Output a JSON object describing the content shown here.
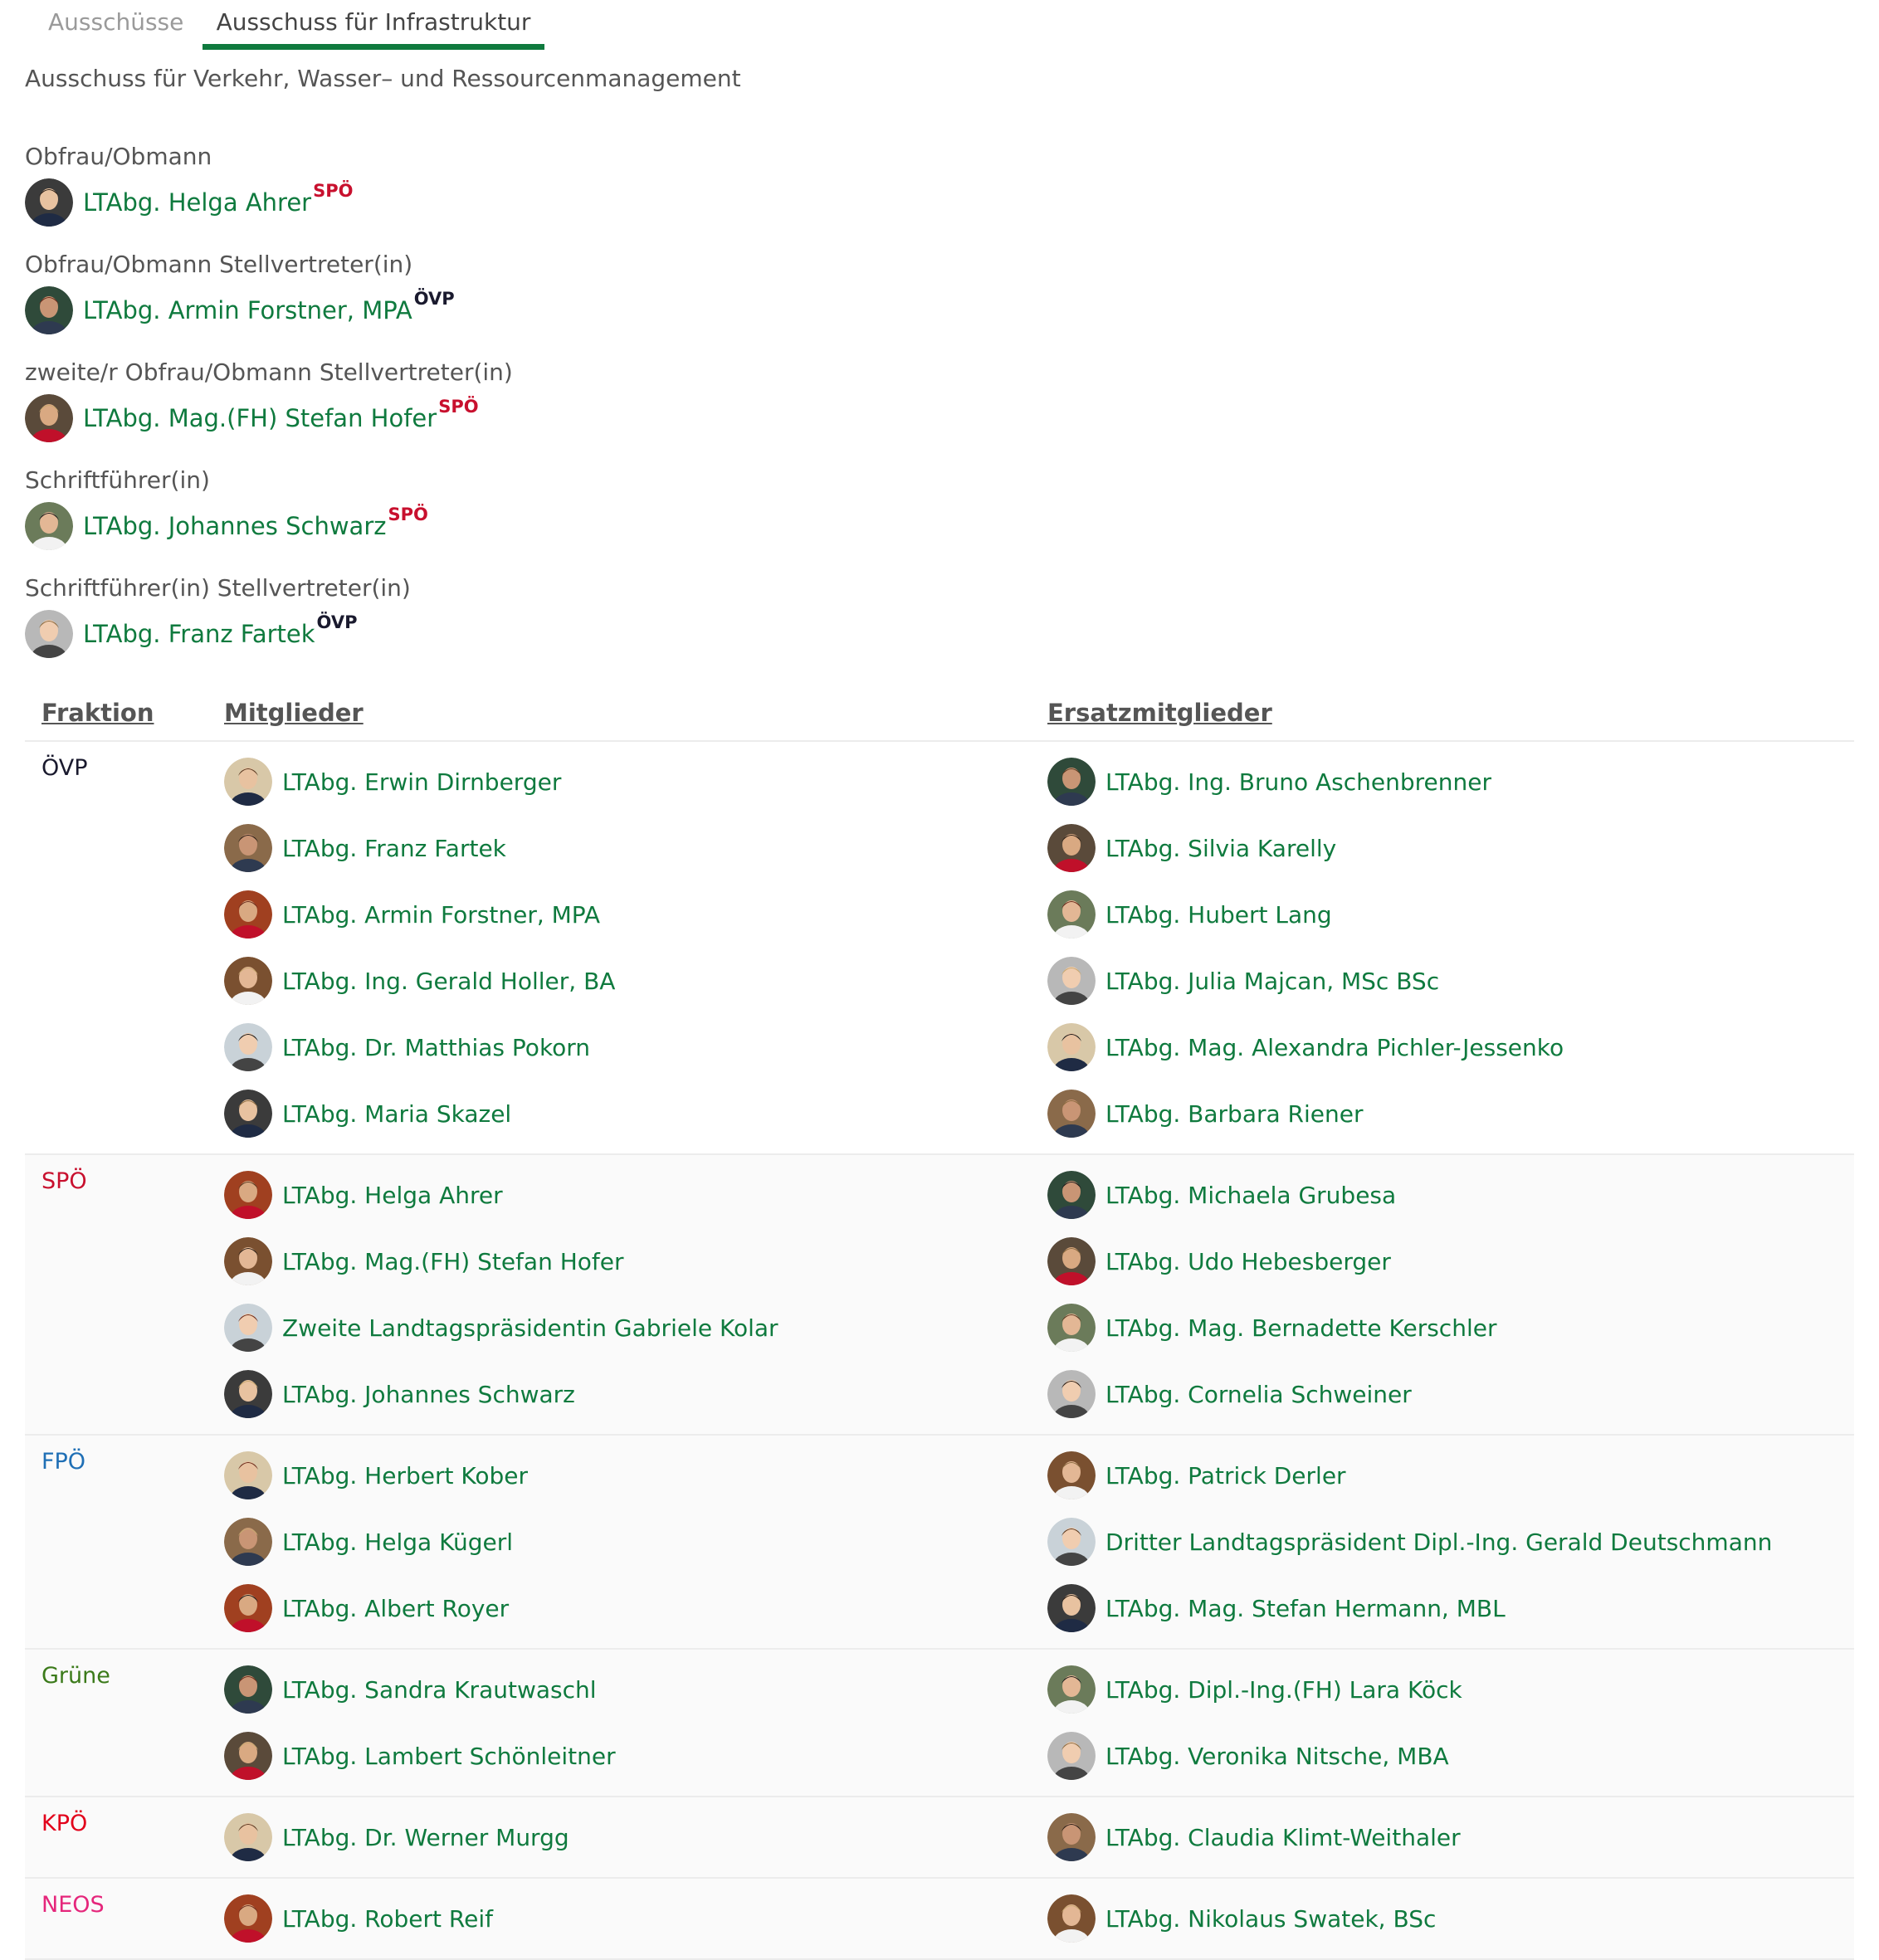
{
  "tabs": [
    {
      "label": "Ausschüsse",
      "active": false
    },
    {
      "label": "Ausschuss für Infrastruktur",
      "active": true
    }
  ],
  "subtitle": "Ausschuss für Verkehr, Wasser– und Ressourcenmanagement",
  "colors": {
    "link": "#0f7a3e",
    "tab_underline": "#0f7a3e",
    "party_spo": "#c8102e",
    "party_ovp": "#1a1a2e",
    "party_fpo": "#1f6fb5",
    "party_grune": "#3b7a1a",
    "party_kpo": "#e2001a",
    "party_neos": "#e5267b"
  },
  "officers": [
    {
      "role": "Obfrau/Obmann",
      "name": "LTAbg. Helga Ahrer",
      "party": "SPÖ"
    },
    {
      "role": "Obfrau/Obmann Stellvertreter(in)",
      "name": "LTAbg. Armin Forstner, MPA",
      "party": "ÖVP"
    },
    {
      "role": "zweite/r Obfrau/Obmann Stellvertreter(in)",
      "name": "LTAbg. Mag.(FH) Stefan Hofer",
      "party": "SPÖ"
    },
    {
      "role": "Schriftführer(in)",
      "name": "LTAbg. Johannes Schwarz",
      "party": "SPÖ"
    },
    {
      "role": "Schriftführer(in) Stellvertreter(in)",
      "name": "LTAbg. Franz Fartek",
      "party": "ÖVP"
    }
  ],
  "table": {
    "headers": {
      "fraktion": "Fraktion",
      "mitglieder": "Mitglieder",
      "ersatz": "Ersatzmitglieder"
    },
    "groups": [
      {
        "fraktion": "ÖVP",
        "color": "#1a1a2e",
        "mitglieder": [
          "LTAbg. Erwin Dirnberger",
          "LTAbg. Franz Fartek",
          "LTAbg. Armin Forstner, MPA",
          "LTAbg. Ing. Gerald Holler, BA",
          "LTAbg. Dr. Matthias Pokorn",
          "LTAbg. Maria Skazel"
        ],
        "ersatz": [
          "LTAbg. Ing. Bruno Aschenbrenner",
          "LTAbg. Silvia Karelly",
          "LTAbg. Hubert Lang",
          "LTAbg. Julia Majcan, MSc BSc",
          "LTAbg. Mag. Alexandra Pichler-Jessenko",
          "LTAbg. Barbara Riener"
        ]
      },
      {
        "fraktion": "SPÖ",
        "color": "#c8102e",
        "mitglieder": [
          "LTAbg. Helga Ahrer",
          "LTAbg. Mag.(FH) Stefan Hofer",
          "Zweite Landtagspräsidentin Gabriele Kolar",
          "LTAbg. Johannes Schwarz"
        ],
        "ersatz": [
          "LTAbg. Michaela Grubesa",
          "LTAbg. Udo Hebesberger",
          "LTAbg. Mag. Bernadette Kerschler",
          "LTAbg. Cornelia Schweiner"
        ]
      },
      {
        "fraktion": "FPÖ",
        "color": "#1f6fb5",
        "mitglieder": [
          "LTAbg. Herbert Kober",
          "LTAbg. Helga Kügerl",
          "LTAbg. Albert Royer"
        ],
        "ersatz": [
          "LTAbg. Patrick Derler",
          "Dritter Landtagspräsident Dipl.-Ing. Gerald Deutschmann",
          "LTAbg. Mag. Stefan Hermann, MBL"
        ]
      },
      {
        "fraktion": "Grüne",
        "color": "#3b7a1a",
        "mitglieder": [
          "LTAbg. Sandra Krautwaschl",
          "LTAbg. Lambert Schönleitner"
        ],
        "ersatz": [
          "LTAbg. Dipl.-Ing.(FH) Lara Köck",
          "LTAbg. Veronika Nitsche, MBA"
        ]
      },
      {
        "fraktion": "KPÖ",
        "color": "#e2001a",
        "mitglieder": [
          "LTAbg. Dr. Werner Murgg"
        ],
        "ersatz": [
          "LTAbg. Claudia Klimt-Weithaler"
        ]
      },
      {
        "fraktion": "NEOS",
        "color": "#e5267b",
        "mitglieder": [
          "LTAbg. Robert Reif"
        ],
        "ersatz": [
          "LTAbg. Nikolaus Swatek, BSc"
        ]
      }
    ]
  }
}
